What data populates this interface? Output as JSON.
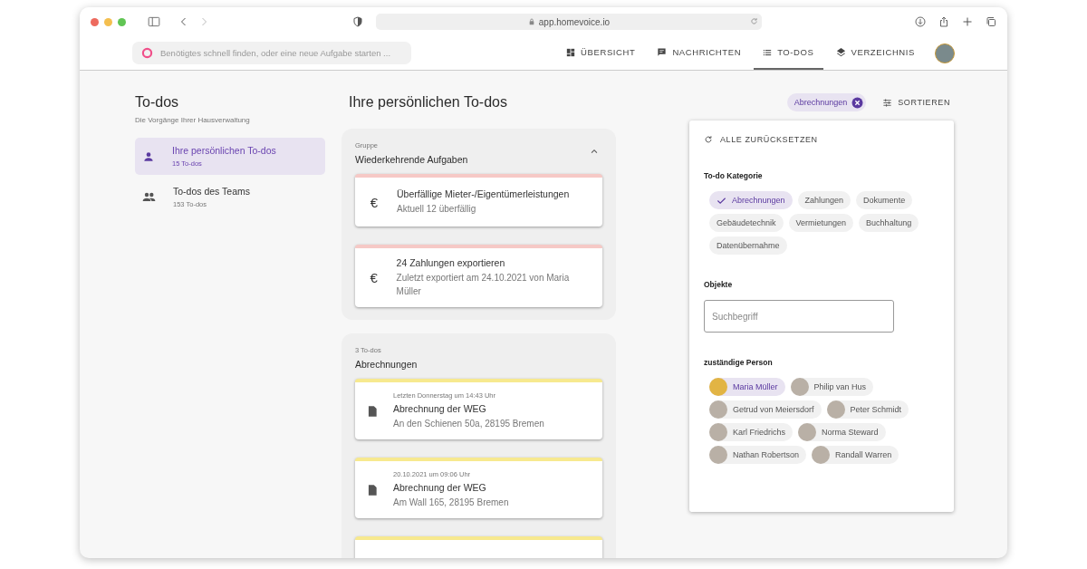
{
  "browser": {
    "url": "app.homevoice.io"
  },
  "header": {
    "search": {
      "placeholder": "Benötigtes schnell finden, oder eine neue Aufgabe starten ..."
    },
    "nav": [
      {
        "label": "ÜBERSICHT",
        "kind": "grid",
        "selected": false
      },
      {
        "label": "NACHRICHTEN",
        "kind": "chat",
        "selected": false
      },
      {
        "label": "TO-DOS",
        "kind": "list",
        "selected": true
      },
      {
        "label": "VERZEICHNIS",
        "kind": "layers",
        "selected": false
      }
    ]
  },
  "sidebar": {
    "title": "To-dos",
    "subtitle": "Die Vorgänge Ihrer Hausverwaltung",
    "items": [
      {
        "label": "Ihre persönlichen To-dos",
        "count": "15 To-dos",
        "kind": "person",
        "selected": true
      },
      {
        "label": "To-dos des Teams",
        "count": "153 To-dos",
        "kind": "group",
        "selected": false
      }
    ]
  },
  "main": {
    "title": "Ihre persönlichen To-dos",
    "groups": [
      {
        "caption": "Gruppe",
        "name": "Wiederkehrende Aufgaben",
        "expanded": true,
        "items": [
          {
            "kind": "euro",
            "symbol": "€",
            "color": "#f6c9c6",
            "title": "Überfällige Mieter-/Eigentümerleistungen",
            "detail": "Aktuell 12 überfällig"
          },
          {
            "kind": "euro",
            "symbol": "€",
            "color": "#f6c9c6",
            "title": "24 Zahlungen exportieren",
            "detail": "Zuletzt exportiert am 24.10.2021 von Maria Müller"
          }
        ]
      },
      {
        "caption": "3 To-dos",
        "name": "Abrechnungen",
        "items": [
          {
            "kind": "document",
            "color": "#f7e98f",
            "time": "Letzten Donnerstag um 14:43 Uhr",
            "title": "Abrechnung der WEG",
            "detail": "An den Schienen 50a, 28195 Bremen"
          },
          {
            "kind": "document",
            "color": "#f7e98f",
            "time": "20.10.2021 um 09:06 Uhr",
            "title": "Abrechnung der WEG",
            "detail": "Am Wall 165, 28195 Bremen"
          },
          {
            "color": "#f7e98f"
          }
        ]
      }
    ]
  },
  "filters": {
    "active_chip": "Abrechnungen",
    "sort": "SORTIEREN",
    "reset": "ALLE ZURÜCKSETZEN",
    "category_label": "To-do Kategorie",
    "categories": [
      {
        "label": "Abrechnungen",
        "selected": true
      },
      {
        "label": "Zahlungen",
        "selected": false
      },
      {
        "label": "Dokumente",
        "selected": false
      },
      {
        "label": "Gebäudetechnik",
        "selected": false
      },
      {
        "label": "Vermietungen",
        "selected": false
      },
      {
        "label": "Buchhaltung",
        "selected": false
      },
      {
        "label": "Datenübernahme",
        "selected": false
      }
    ],
    "objects_label": "Objekte",
    "objects_search": {
      "placeholder": "Suchbegriff"
    },
    "person_label": "zuständige Person",
    "persons": [
      {
        "name": "Maria Müller",
        "selected": true
      },
      {
        "name": "Philip van Hus",
        "selected": false
      },
      {
        "name": "Getrud von Meiersdorf",
        "selected": false
      },
      {
        "name": "Peter Schmidt",
        "selected": false
      },
      {
        "name": "Karl Friedrichs",
        "selected": false
      },
      {
        "name": "Norma Steward",
        "selected": false
      },
      {
        "name": "Nathan Robertson",
        "selected": false
      },
      {
        "name": "Randall Warren",
        "selected": false
      }
    ]
  }
}
